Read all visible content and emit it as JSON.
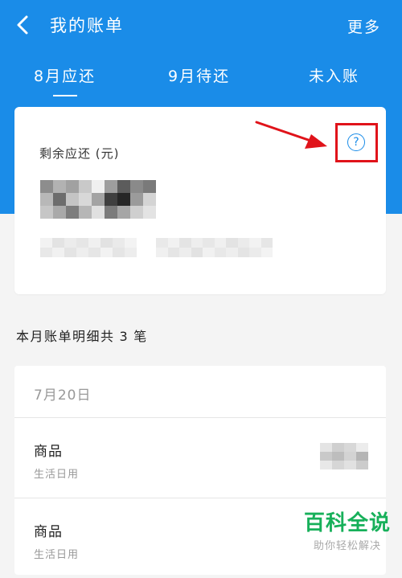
{
  "header": {
    "title": "我的账单",
    "more_label": "更多"
  },
  "tabs": [
    {
      "label": "8月应还",
      "active": true
    },
    {
      "label": "9月待还",
      "active": false
    },
    {
      "label": "未入账",
      "active": false
    }
  ],
  "summary": {
    "remaining_label": "剩余应还 (元)",
    "help_icon": "question-circle-icon",
    "annotation_color": "#e0131a"
  },
  "details": {
    "count_prefix": "本月账单明细共",
    "count": "3",
    "count_suffix": "笔",
    "date": "7月20日",
    "items": [
      {
        "name": "商品",
        "category": "生活日用"
      },
      {
        "name": "商品",
        "category": "生活日用"
      }
    ]
  },
  "watermark": {
    "main": "百科全说",
    "sub": "助你轻松解决"
  },
  "colors": {
    "primary": "#1a8ce8",
    "background": "#f4f4f4"
  }
}
